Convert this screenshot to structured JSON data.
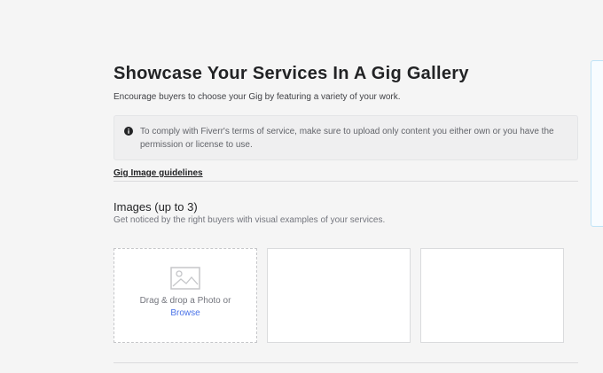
{
  "header": {
    "title": "Showcase Your Services In A Gig Gallery",
    "subtitle": "Encourage buyers to choose your Gig by featuring a variety of your work."
  },
  "notice": {
    "icon": "info-icon",
    "text": "To comply with Fiverr's terms of service, make sure to upload only content you either own or you have the permission or license to use."
  },
  "guidelines": {
    "link_label": "Gig Image guidelines"
  },
  "images_section": {
    "title": "Images (up to 3)",
    "description": "Get noticed by the right buyers with visual examples of your services.",
    "upload_slot": {
      "icon": "image-placeholder-icon",
      "prompt": "Drag & drop a Photo or",
      "browse_label": "Browse"
    }
  },
  "colors": {
    "background": "#f5f5f5",
    "link_blue": "#4a73e8",
    "notice_bg": "#efeff0",
    "panel_border": "#bfe3f7"
  }
}
